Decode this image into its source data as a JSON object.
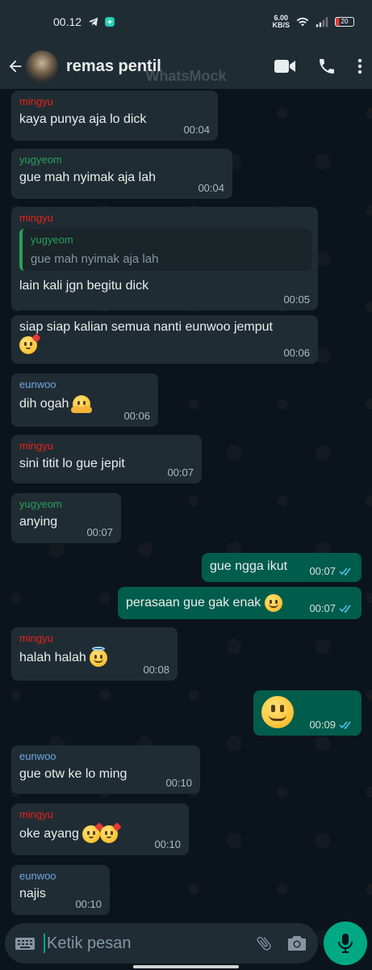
{
  "status_bar": {
    "time": "00.12",
    "net_speed_value": "6.00",
    "net_speed_unit": "KB/S",
    "battery": "20"
  },
  "header": {
    "title": "remas pentil",
    "watermark": "WhatsMock"
  },
  "colors": {
    "mingyu": "#e5221c",
    "yugyeom": "#25a15a",
    "eunwoo": "#6ea7e0",
    "accent": "#00a884",
    "outgoing": "#005c4b",
    "incoming": "#202c33"
  },
  "messages": [
    {
      "dir": "in",
      "sender": "mingyu",
      "text": "kaya punya aja lo dick",
      "time": "00:04"
    },
    {
      "dir": "in",
      "sender": "yugyeom",
      "text": "gue mah nyimak aja lah",
      "time": "00:04"
    },
    {
      "dir": "in",
      "sender": "mingyu",
      "quote_sender": "yugyeom",
      "quote_text": "gue mah nyimak aja lah",
      "text": "lain kali jgn begitu dick",
      "time": "00:05"
    },
    {
      "dir": "in",
      "sender": "",
      "text": "siap siap kalian semua nanti eunwoo jemput",
      "emoji": "kiss-icon",
      "time": "00:06"
    },
    {
      "dir": "in",
      "sender": "eunwoo",
      "text": "dih ogah",
      "emoji": "hug-icon",
      "time": "00:06"
    },
    {
      "dir": "in",
      "sender": "mingyu",
      "text": "sini titit lo gue jepit",
      "time": "00:07"
    },
    {
      "dir": "in",
      "sender": "yugyeom",
      "text": "anying",
      "time": "00:07"
    },
    {
      "dir": "out",
      "text": "gue ngga ikut",
      "time": "00:07"
    },
    {
      "dir": "out",
      "text": "perasaan gue gak enak",
      "emoji": "grin-icon",
      "time": "00:07"
    },
    {
      "dir": "in",
      "sender": "mingyu",
      "text": "halah halah",
      "emoji": "halo-icon",
      "time": "00:08"
    },
    {
      "dir": "out",
      "text": "",
      "emoji": "big-grin-icon",
      "time": "00:09"
    },
    {
      "dir": "in",
      "sender": "eunwoo",
      "text": "gue otw ke lo ming",
      "time": "00:10"
    },
    {
      "dir": "in",
      "sender": "mingyu",
      "text": "oke ayang",
      "emoji": "kiss-icon x2",
      "time": "00:10"
    },
    {
      "dir": "in",
      "sender": "eunwoo",
      "text": "najis",
      "time": "00:10"
    }
  ],
  "input": {
    "placeholder": "Ketik pesan"
  }
}
